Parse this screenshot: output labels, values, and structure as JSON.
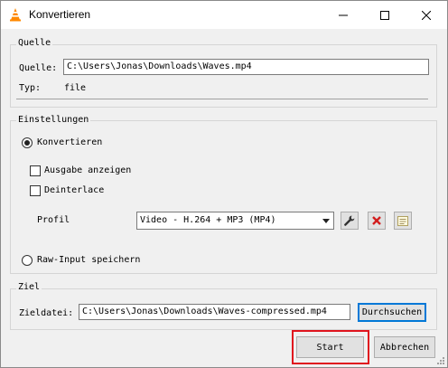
{
  "window": {
    "title": "Konvertieren"
  },
  "source": {
    "group_label": "Quelle",
    "source_label": "Quelle:",
    "source_value": "C:\\Users\\Jonas\\Downloads\\Waves.mp4",
    "type_label": "Typ:",
    "type_value": "file"
  },
  "settings": {
    "group_label": "Einstellungen",
    "convert_label": "Konvertieren",
    "show_output_label": "Ausgabe anzeigen",
    "deinterlace_label": "Deinterlace",
    "profile_label": "Profil",
    "profile_value": "Video - H.264 + MP3 (MP4)",
    "raw_input_label": "Raw-Input speichern"
  },
  "target": {
    "group_label": "Ziel",
    "file_label": "Zieldatei:",
    "file_value": "C:\\Users\\Jonas\\Downloads\\Waves-compressed.mp4",
    "browse_label": "Durchsuchen"
  },
  "actions": {
    "start_label": "Start",
    "cancel_label": "Abbrechen"
  },
  "colors": {
    "highlight": "#e0141e",
    "accent": "#0078d7",
    "vlc_orange": "#ff8800"
  }
}
